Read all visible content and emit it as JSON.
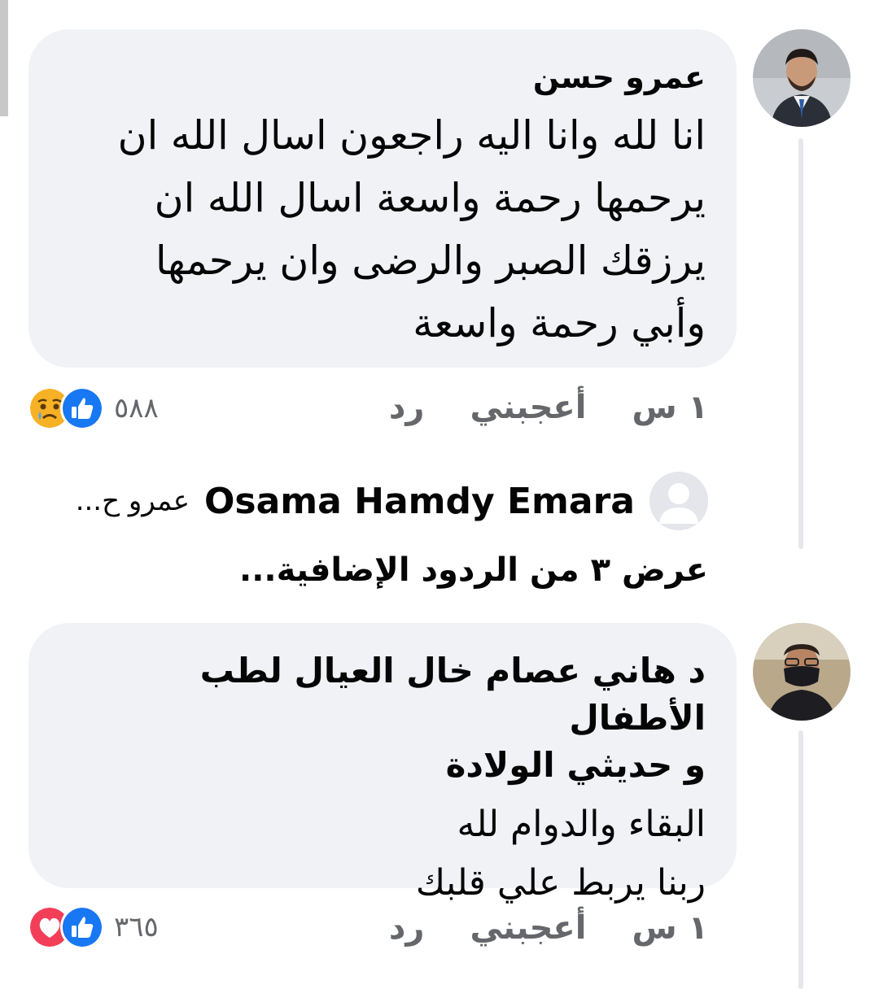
{
  "comments": [
    {
      "author": "عمرو حسن",
      "text": "انا لله وانا اليه راجعون اسال الله ان\nيرحمها رحمة واسعة اسال الله ان\nيرزقك الصبر والرضى وان يرحمها\nوأبي رحمة واسعة",
      "time": "١ س",
      "like_label": "أعجبني",
      "reply_label": "رد",
      "reaction_count": "٥٨٨",
      "reactions": [
        "like-icon",
        "sad-icon"
      ]
    },
    {
      "author_line": "د هاني عصام خال العيال لطب الأطفال\nو حديثي الولادة",
      "text": "البقاء والدوام لله\nربنا يربط علي قلبك",
      "time": "١ س",
      "like_label": "أعجبني",
      "reply_label": "رد",
      "reaction_count": "٣٦٥",
      "reactions": [
        "like-icon",
        "love-icon"
      ]
    }
  ],
  "reply_preview": {
    "author": "Osama Hamdy Emara",
    "snippet": "عمرو ح..."
  },
  "more_replies_label": "عرض ٣ من الردود الإضافية...",
  "colors": {
    "bubble": "#f0f2f5",
    "meta_text": "#65676b",
    "like_blue": "#1877f2",
    "love_red": "#f33e58",
    "sad_yellow": "#f7b125"
  }
}
